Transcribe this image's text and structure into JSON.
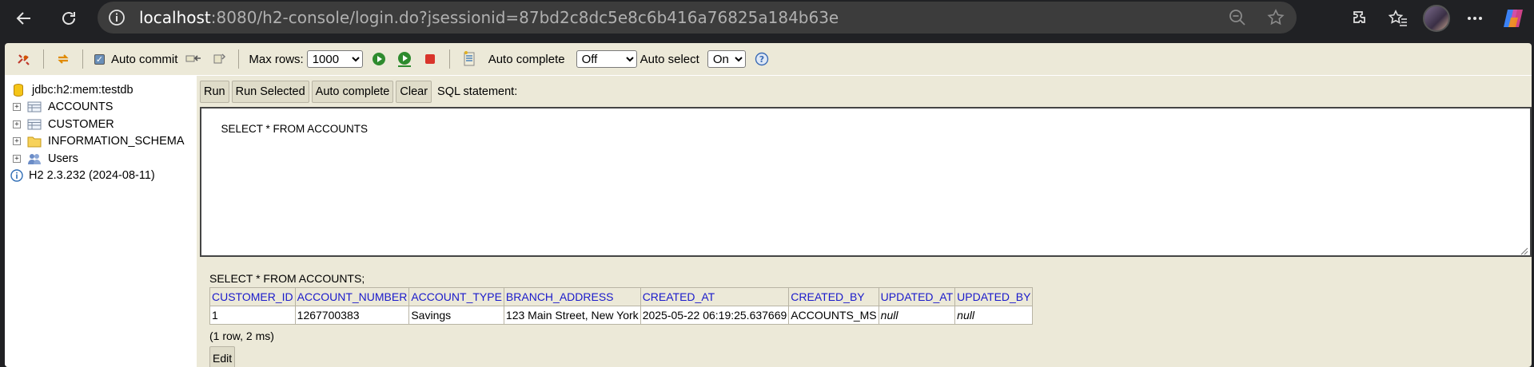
{
  "browser": {
    "url_host": "localhost",
    "url_path": ":8080/h2-console/login.do?jsessionid=87bd2c8dc5e8c6b416a76825a184b63e",
    "icons": [
      "back-arrow-icon",
      "reload-icon",
      "info-icon",
      "zoom-out-icon",
      "star-icon",
      "extensions-icon",
      "favorites-icon",
      "avatar",
      "more-icon",
      "copilot-icon"
    ]
  },
  "toolbar": {
    "auto_commit_label": "Auto commit",
    "auto_commit_checked": true,
    "max_rows_label": "Max rows:",
    "max_rows_value": "1000",
    "auto_complete_label": "Auto complete",
    "auto_complete_value": "Off",
    "auto_select_label": "Auto select",
    "auto_select_value": "On"
  },
  "tree": {
    "connection": "jdbc:h2:mem:testdb",
    "items": [
      {
        "label": "ACCOUNTS",
        "icon": "table-icon"
      },
      {
        "label": "CUSTOMER",
        "icon": "table-icon"
      },
      {
        "label": "INFORMATION_SCHEMA",
        "icon": "folder-icon"
      },
      {
        "label": "Users",
        "icon": "users-icon"
      }
    ],
    "version": "H2 2.3.232 (2024-08-11)"
  },
  "editor": {
    "run_label": "Run",
    "run_selected_label": "Run Selected",
    "auto_complete_label": "Auto complete",
    "clear_label": "Clear",
    "sql_label": "SQL statement:",
    "sql_text": "SELECT * FROM ACCOUNTS"
  },
  "result": {
    "statement": "SELECT * FROM ACCOUNTS;",
    "columns": [
      "CUSTOMER_ID",
      "ACCOUNT_NUMBER",
      "ACCOUNT_TYPE",
      "BRANCH_ADDRESS",
      "CREATED_AT",
      "CREATED_BY",
      "UPDATED_AT",
      "UPDATED_BY"
    ],
    "rows": [
      [
        "1",
        "1267700383",
        "Savings",
        "123 Main Street, New York",
        "2025-05-22 06:19:25.637669",
        "ACCOUNTS_MS",
        "null",
        "null"
      ]
    ],
    "summary": "(1 row, 2 ms)",
    "edit_label": "Edit"
  },
  "colors": {
    "panel_bg": "#ece9d8",
    "header_text": "#1a1acb",
    "chrome_bg": "#202124"
  }
}
